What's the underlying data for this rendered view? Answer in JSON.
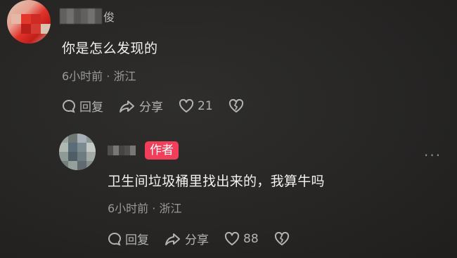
{
  "comment": {
    "username_suffix": "俊",
    "text": "你是怎么发现的",
    "time_location": "6小时前 · 浙江",
    "reply_label": "回复",
    "share_label": "分享",
    "like_count": "21"
  },
  "reply": {
    "author_badge": "作者",
    "text": "卫生间垃圾桶里找出来的，我算牛吗",
    "time_location": "6小时前 · 浙江",
    "reply_label": "回复",
    "share_label": "分享",
    "like_count": "88"
  },
  "colors": {
    "badge": "#f13f5b",
    "background": "#262524"
  },
  "icons": [
    "comment-bubble-icon",
    "share-arrow-icon",
    "heart-icon",
    "broken-heart-icon",
    "more-dots-icon"
  ]
}
